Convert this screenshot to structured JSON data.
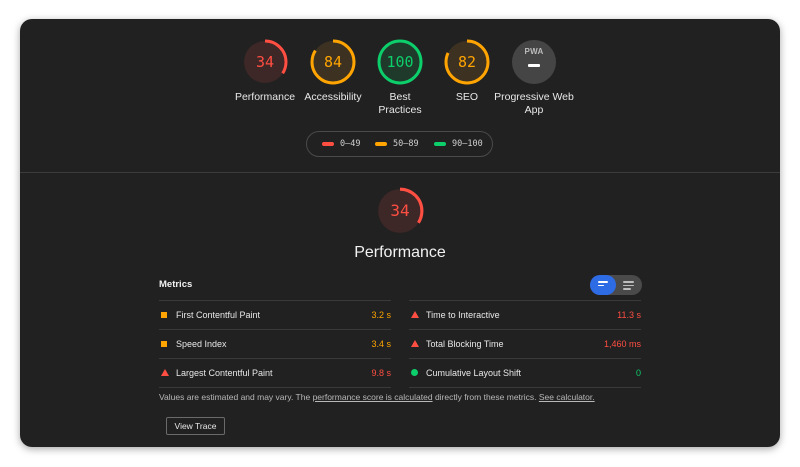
{
  "colors": {
    "fail": "#ff4e42",
    "average": "#ffa400",
    "pass": "#0cce6b",
    "na": "#9e9e9e"
  },
  "gauges": [
    {
      "score": "34",
      "label": "Performance",
      "level": "fail",
      "fraction": 0.34
    },
    {
      "score": "84",
      "label": "Accessibility",
      "level": "average",
      "fraction": 0.84
    },
    {
      "score": "100",
      "label": "Best Practices",
      "level": "pass",
      "fraction": 1.0
    },
    {
      "score": "82",
      "label": "SEO",
      "level": "average",
      "fraction": 0.82
    }
  ],
  "pwa": {
    "badge_text": "PWA",
    "label": "Progressive Web App",
    "icon": "pwa-badge-icon"
  },
  "legend": [
    {
      "range": "0–49",
      "level": "fail"
    },
    {
      "range": "50–89",
      "level": "average"
    },
    {
      "range": "90–100",
      "level": "pass"
    }
  ],
  "category": {
    "score": "34",
    "title": "Performance",
    "fraction": 0.34,
    "level": "fail"
  },
  "metrics": {
    "header": "Metrics",
    "view_toggle": {
      "active": "summary",
      "icons": [
        "summary-view-icon",
        "list-view-icon"
      ]
    },
    "left": [
      {
        "name": "First Contentful Paint",
        "value": "3.2 s",
        "level": "average"
      },
      {
        "name": "Speed Index",
        "value": "3.4 s",
        "level": "average"
      },
      {
        "name": "Largest Contentful Paint",
        "value": "9.8 s",
        "level": "fail"
      }
    ],
    "right": [
      {
        "name": "Time to Interactive",
        "value": "11.3 s",
        "level": "fail"
      },
      {
        "name": "Total Blocking Time",
        "value": "1,460 ms",
        "level": "fail"
      },
      {
        "name": "Cumulative Layout Shift",
        "value": "0",
        "level": "pass"
      }
    ]
  },
  "note": {
    "prefix": "Values are estimated and may vary. The ",
    "link1": "performance score is calculated",
    "middle": " directly from these metrics. ",
    "link2": "See calculator."
  },
  "view_trace": "View Trace"
}
